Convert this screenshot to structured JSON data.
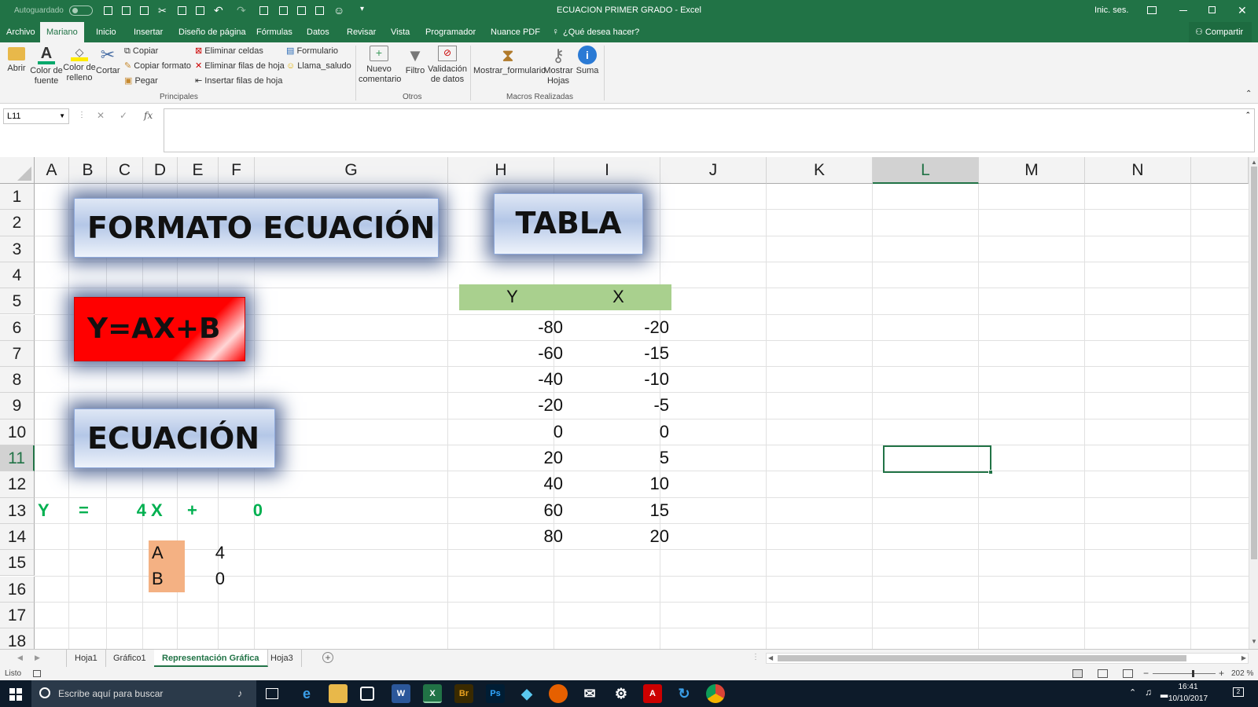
{
  "window": {
    "autosave_label": "Autoguardado",
    "title": "ECUACION PRIMER GRADO  -  Excel",
    "signin": "Inic. ses."
  },
  "menu": {
    "tabs": [
      "Archivo",
      "Mariano",
      "Inicio",
      "Insertar",
      "Diseño de página",
      "Fórmulas",
      "Datos",
      "Revisar",
      "Vista",
      "Programador",
      "Nuance PDF"
    ],
    "active_tab": "Mariano",
    "tell_me": "¿Qué desea hacer?",
    "share": "Compartir"
  },
  "ribbon": {
    "abrir": "Abrir",
    "color_fuente": "Color de fuente",
    "color_relleno": "Color de relleno",
    "cortar": "Cortar",
    "copiar": "Copiar",
    "copiar_formato": "Copiar formato",
    "pegar": "Pegar",
    "eliminar_celdas": "Eliminar celdas",
    "eliminar_filas": "Eliminar filas de hoja",
    "insertar_filas": "Insertar filas de hoja",
    "formulario": "Formulario",
    "llama_saludo": "Llama_saludo",
    "group_principales": "Principales",
    "nuevo_comentario": "Nuevo comentario",
    "filtro": "Filtro",
    "validacion": "Validación de datos",
    "group_otros": "Otros",
    "mostrar_formulario": "Mostrar_formulario",
    "mostrar_hojas": "Mostrar Hojas",
    "suma": "Suma",
    "group_macros": "Macros Realizadas"
  },
  "formula_bar": {
    "name_box": "L11",
    "fx": "fx",
    "value": ""
  },
  "columns": [
    "A",
    "B",
    "C",
    "D",
    "E",
    "F",
    "G",
    "H",
    "I",
    "J",
    "K",
    "L",
    "M",
    "N"
  ],
  "rows": [
    "1",
    "2",
    "3",
    "4",
    "5",
    "6",
    "7",
    "8",
    "9",
    "10",
    "11",
    "12",
    "13",
    "14",
    "15",
    "16",
    "17",
    "18"
  ],
  "selected_cell": "L11",
  "shapes": {
    "formato": "FORMATO ECUACIÓN",
    "tabla": "TABLA",
    "ecuacion_general": "Y=AX+B",
    "ecuacion": "ECUACIÓN"
  },
  "equation_row": {
    "y": "Y",
    "eq": "=",
    "a": "4",
    "x": "X",
    "plus": "+",
    "b": "0"
  },
  "params": {
    "a_label": "A",
    "a_value": "4",
    "b_label": "B",
    "b_value": "0"
  },
  "table": {
    "header_y": "Y",
    "header_x": "X",
    "y": [
      "-80",
      "-60",
      "-40",
      "-20",
      "0",
      "20",
      "40",
      "60",
      "80"
    ],
    "x": [
      "-20",
      "-15",
      "-10",
      "-5",
      "0",
      "5",
      "10",
      "15",
      "20"
    ]
  },
  "sheets": [
    "Hoja1",
    "Gráfico1",
    "Representación Gráfica",
    "Hoja3"
  ],
  "active_sheet": "Representación Gráfica",
  "status": {
    "ready": "Listo",
    "zoom": "202 %"
  },
  "taskbar": {
    "search_placeholder": "Escribe aquí para buscar",
    "time": "16:41",
    "date": "10/10/2017",
    "notifications": "2"
  },
  "colors": {
    "excel_green": "#217346",
    "header_green": "#a9d08e",
    "param_orange": "#f4b183",
    "equation_green": "#00b050",
    "red_box": "#ff0000",
    "blue_box": "#b4c7e7"
  }
}
